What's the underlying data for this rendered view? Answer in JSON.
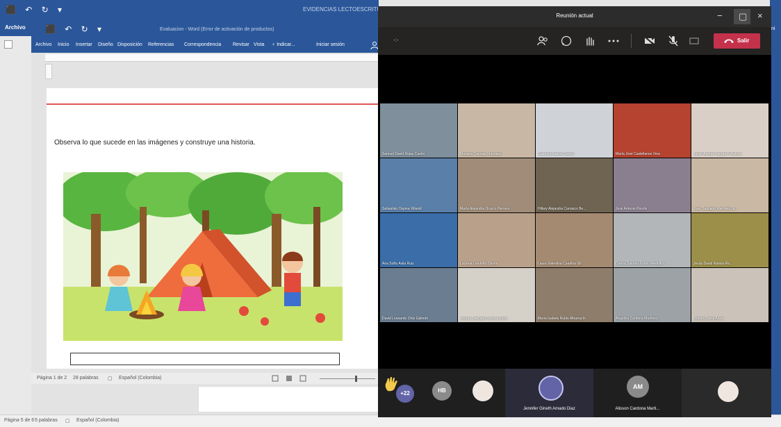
{
  "outer_window": {
    "quick_access": "⬛ ↶ ↻ ▾",
    "title": "EVIDENCIAS LECTOESCRITUR",
    "file_tab": "Archivo",
    "right_label": "ni",
    "status": [
      "Página 5 de 6",
      "5 palabras",
      "Español (Colombia)"
    ]
  },
  "word": {
    "quick_access": "⬛ ↶ ↻ ▾",
    "title": "Evaluacion - Word (Error de activación de productos)",
    "tabs": [
      "Archivo",
      "Inicio",
      "Insertar",
      "Diseño",
      "Disposición",
      "Referencias",
      "Correspondencia",
      "Revisar",
      "Vista",
      "♀ Indicar...",
      "Iniciar sesión"
    ],
    "instruction": "Observa lo que sucede en las imágenes y construye una historia.",
    "status": [
      "Página 1 de 2",
      "28 palabras",
      "Español (Colombia)"
    ]
  },
  "teams": {
    "title": "Reunión actual",
    "timer": "-:-",
    "leave_label": "Salir",
    "participants": [
      "Samuel David Rojas Castro",
      "Mariana Carvajal Manrique",
      "Gabriela Santos Castro",
      "María José Castellanos Vera",
      "Julián Andrés Vargas Peñaloza",
      "Sebastián Ospina Villamil",
      "María Alejandra Orozco Herrera",
      "Hillary Alejandra Carrasco Be...",
      "José Antonio Pinzón",
      "Juan Santiago Martínez Gil",
      "Ana Sofía Ávila Ruiz",
      "Luciana Londoño Osorio",
      "Laura Valentina Cuadros Gil",
      "Danna Saloma Pabón Medellín",
      "Jesús David Ramos Ro...",
      "David Leonardo Ortiz Galindo",
      "Andrés Santiago Moreno Marti",
      "María Isabela Rubio Albarracín",
      "Angélica Cardona Martínez",
      "Moisés Ibarra Ariza"
    ],
    "tray": {
      "extra_count": "+22",
      "hb_initials": "HB",
      "featured_name": "Jennifer Gineth Amado Diaz",
      "am_initials": "AM",
      "am_name": "Alisson Cardona Marti..."
    }
  },
  "colors": {
    "word_blue": "#2b579a",
    "leave_red": "#c4314b",
    "teams_dark": "#252423"
  }
}
